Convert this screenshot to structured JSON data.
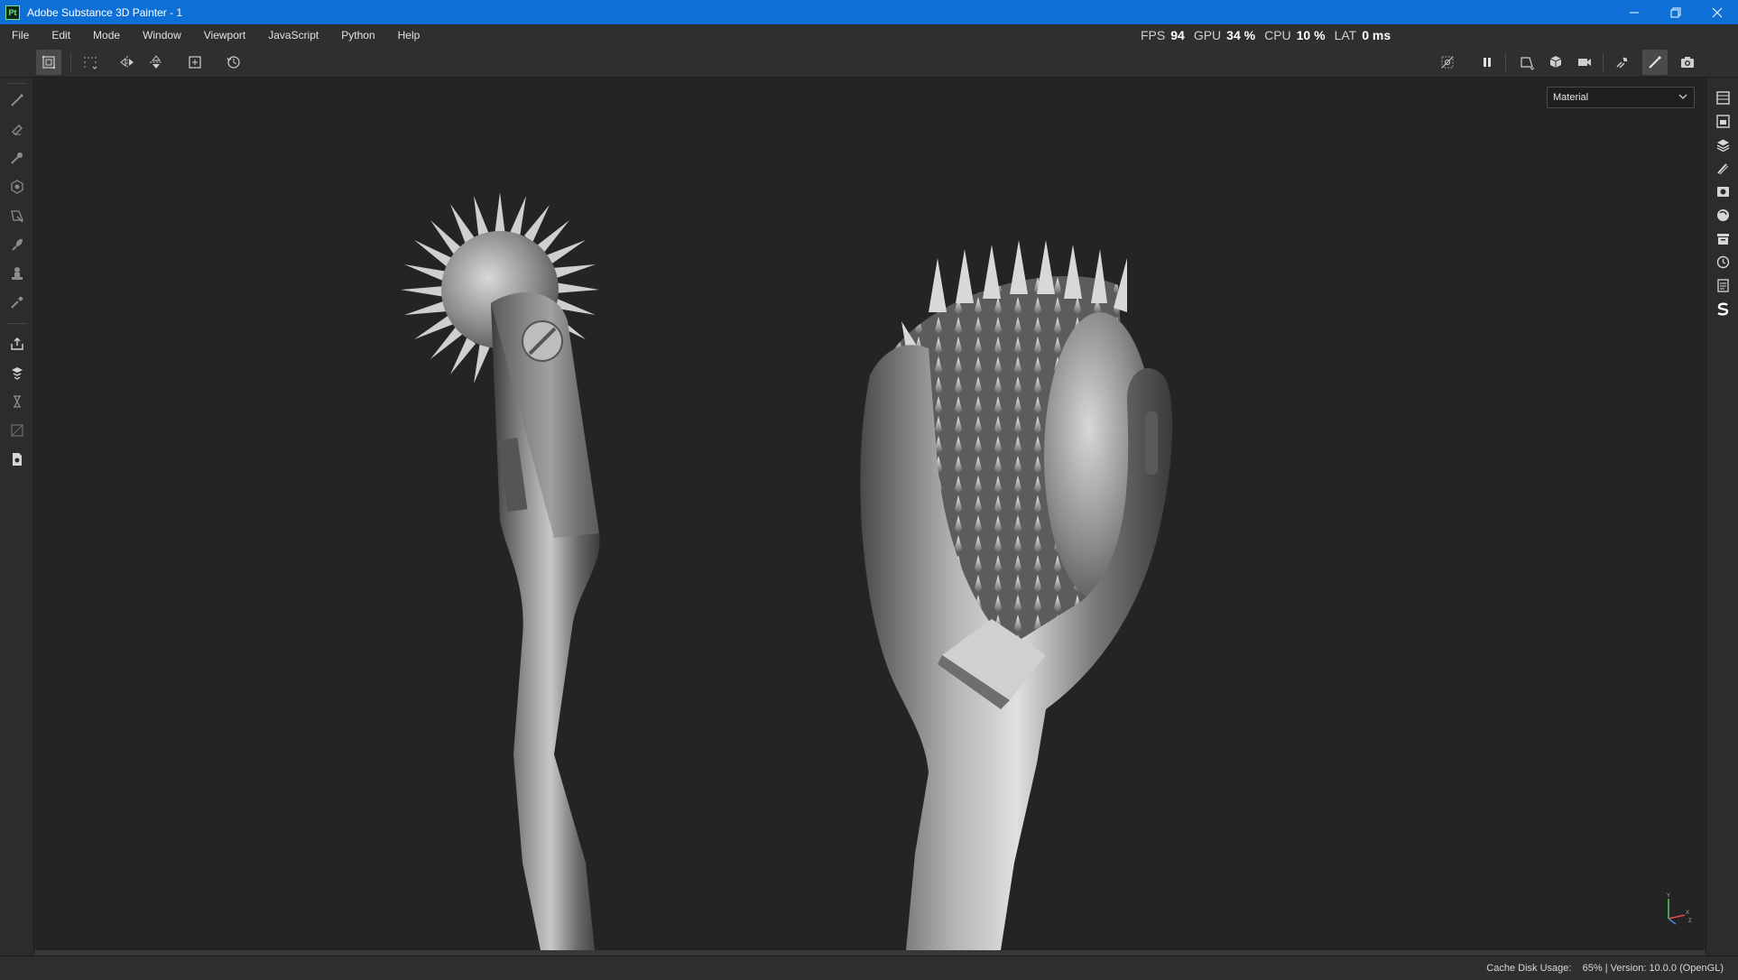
{
  "window": {
    "logo_text": "Pt",
    "title": "Adobe Substance 3D Painter - 1",
    "controls": [
      "minimize-icon",
      "restore-icon",
      "close-icon"
    ]
  },
  "menu": {
    "items": [
      "File",
      "Edit",
      "Mode",
      "Window",
      "Viewport",
      "JavaScript",
      "Python",
      "Help"
    ]
  },
  "performance": {
    "fps_label": "FPS",
    "fps_value": "94",
    "gpu_label": "GPU",
    "gpu_value": "34 %",
    "cpu_label": "CPU",
    "cpu_value": "10 %",
    "lat_label": "LAT",
    "lat_value": "0 ms"
  },
  "toolbar": {
    "left_icons": [
      "paint-tool-settings-icon",
      "selection-grid-icon",
      "symmetry-x-icon",
      "symmetry-y-icon",
      "add-frame-icon",
      "history-reset-icon"
    ],
    "right_icons": [
      "hide-icon",
      "pause-icon",
      "2d-view-icon",
      "3d-view-icon",
      "camera-icon",
      "bake-icon",
      "brush-icon",
      "screenshot-icon"
    ]
  },
  "left_tools": [
    "paint-icon",
    "eraser-icon",
    "projection-icon",
    "geometry-fill-icon",
    "polygon-fill-icon",
    "smudge-icon",
    "clone-icon",
    "color-picker-icon",
    "export-icon",
    "bake-mesh-icon",
    "layer-stack-icon",
    "mask-icon",
    "document-icon"
  ],
  "right_panels": [
    "layers-panel-icon",
    "texture-set-icon",
    "stack-icon",
    "brush-settings-icon",
    "display-settings-icon",
    "shader-icon",
    "assets-icon",
    "history-icon",
    "log-icon",
    "substance-icon"
  ],
  "viewport": {
    "channel_select": "Material",
    "axis_labels": {
      "y": "Y",
      "x": "X",
      "z": "Z"
    },
    "objects": [
      "pinwheel-roller-single",
      "pinwheel-roller-multi"
    ]
  },
  "status": {
    "text": "Cache Disk Usage:    65% | Version: 10.0.0 (OpenGL)"
  },
  "colors": {
    "titlebar": "#0e6fd6",
    "background": "#2b2b2b",
    "viewport": "#242424"
  }
}
